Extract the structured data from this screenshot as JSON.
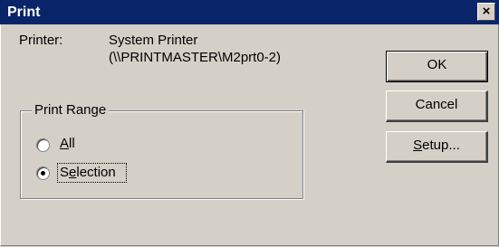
{
  "window": {
    "title": "Print",
    "close_glyph": "×"
  },
  "printer": {
    "label": "Printer:",
    "name": "System Printer",
    "path": "(\\\\PRINTMASTER\\M2prt0-2)"
  },
  "print_range": {
    "legend": "Print Range",
    "options": [
      {
        "label": "All",
        "accel": "A",
        "rest": "ll",
        "selected": false
      },
      {
        "label": "Selection",
        "accel": "e",
        "pre": "S",
        "rest": "lection",
        "selected": true
      }
    ]
  },
  "buttons": {
    "ok": "OK",
    "cancel": "Cancel",
    "setup_accel": "S",
    "setup_rest": "etup..."
  },
  "icons": {
    "close": "close-icon"
  }
}
